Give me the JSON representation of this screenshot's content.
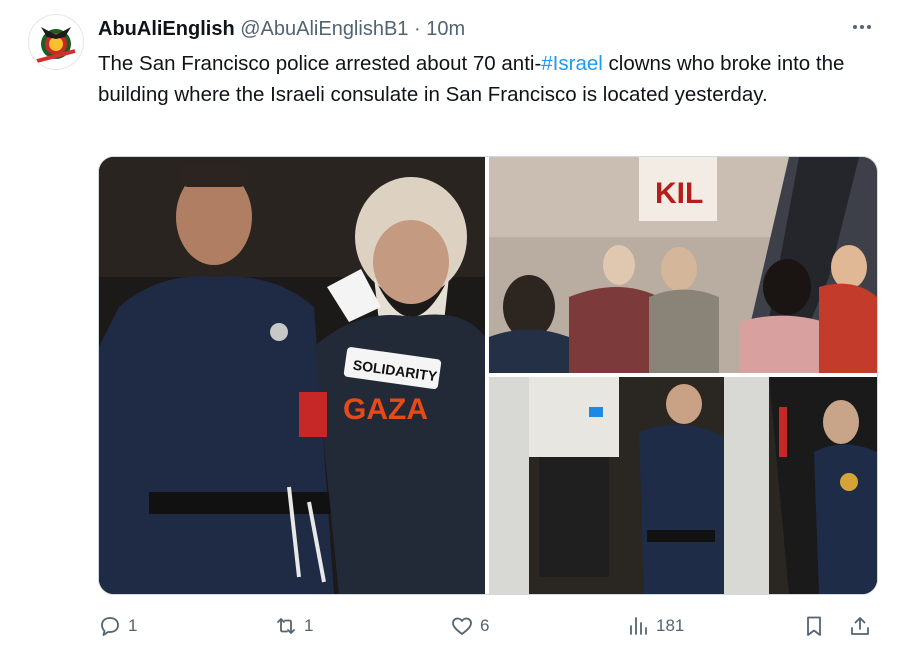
{
  "tweet": {
    "display_name": "AbuAliEnglish",
    "handle": "@AbuAliEnglishB1",
    "separator": "·",
    "time": "10m",
    "text_before": "The San Francisco police arrested about 70 anti-",
    "hashtag": "#Israel",
    "text_after": " clowns who broke into the building where the Israeli consulate in San Francisco is located yesterday."
  },
  "media": {
    "photo1": {
      "shirt_line1": "SOLIDARITY",
      "shirt_line2": "GAZA"
    },
    "photo2": {
      "banner": "KIL"
    }
  },
  "actions": {
    "replies": "1",
    "reposts": "1",
    "likes": "6",
    "views": "181"
  },
  "icons": {
    "more": "more-horizontal-icon",
    "reply": "reply-bubble-icon",
    "repost": "repost-arrows-icon",
    "like": "heart-icon",
    "views": "bar-chart-icon",
    "bookmark": "bookmark-icon",
    "share": "share-upload-icon"
  },
  "colors": {
    "text": "#0f1419",
    "secondary": "#536471",
    "link": "#1d9bf0"
  }
}
